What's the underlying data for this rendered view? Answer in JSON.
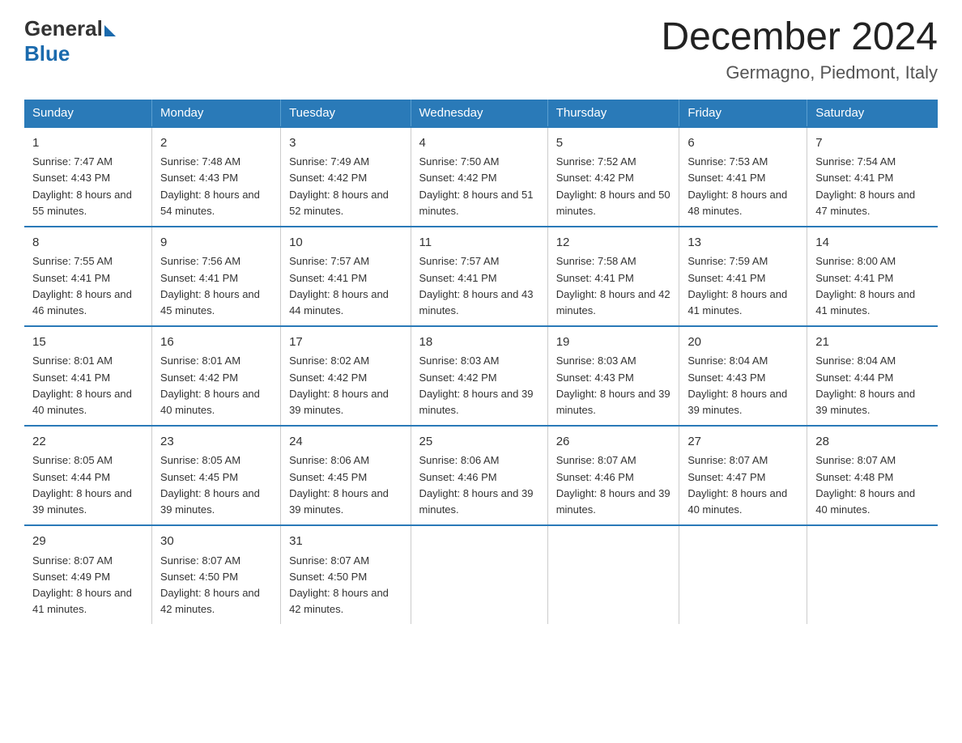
{
  "logo": {
    "general": "General",
    "blue": "Blue"
  },
  "title": "December 2024",
  "subtitle": "Germagno, Piedmont, Italy",
  "days_header": [
    "Sunday",
    "Monday",
    "Tuesday",
    "Wednesday",
    "Thursday",
    "Friday",
    "Saturday"
  ],
  "weeks": [
    [
      {
        "day": "1",
        "sunrise": "7:47 AM",
        "sunset": "4:43 PM",
        "daylight": "8 hours and 55 minutes."
      },
      {
        "day": "2",
        "sunrise": "7:48 AM",
        "sunset": "4:43 PM",
        "daylight": "8 hours and 54 minutes."
      },
      {
        "day": "3",
        "sunrise": "7:49 AM",
        "sunset": "4:42 PM",
        "daylight": "8 hours and 52 minutes."
      },
      {
        "day": "4",
        "sunrise": "7:50 AM",
        "sunset": "4:42 PM",
        "daylight": "8 hours and 51 minutes."
      },
      {
        "day": "5",
        "sunrise": "7:52 AM",
        "sunset": "4:42 PM",
        "daylight": "8 hours and 50 minutes."
      },
      {
        "day": "6",
        "sunrise": "7:53 AM",
        "sunset": "4:41 PM",
        "daylight": "8 hours and 48 minutes."
      },
      {
        "day": "7",
        "sunrise": "7:54 AM",
        "sunset": "4:41 PM",
        "daylight": "8 hours and 47 minutes."
      }
    ],
    [
      {
        "day": "8",
        "sunrise": "7:55 AM",
        "sunset": "4:41 PM",
        "daylight": "8 hours and 46 minutes."
      },
      {
        "day": "9",
        "sunrise": "7:56 AM",
        "sunset": "4:41 PM",
        "daylight": "8 hours and 45 minutes."
      },
      {
        "day": "10",
        "sunrise": "7:57 AM",
        "sunset": "4:41 PM",
        "daylight": "8 hours and 44 minutes."
      },
      {
        "day": "11",
        "sunrise": "7:57 AM",
        "sunset": "4:41 PM",
        "daylight": "8 hours and 43 minutes."
      },
      {
        "day": "12",
        "sunrise": "7:58 AM",
        "sunset": "4:41 PM",
        "daylight": "8 hours and 42 minutes."
      },
      {
        "day": "13",
        "sunrise": "7:59 AM",
        "sunset": "4:41 PM",
        "daylight": "8 hours and 41 minutes."
      },
      {
        "day": "14",
        "sunrise": "8:00 AM",
        "sunset": "4:41 PM",
        "daylight": "8 hours and 41 minutes."
      }
    ],
    [
      {
        "day": "15",
        "sunrise": "8:01 AM",
        "sunset": "4:41 PM",
        "daylight": "8 hours and 40 minutes."
      },
      {
        "day": "16",
        "sunrise": "8:01 AM",
        "sunset": "4:42 PM",
        "daylight": "8 hours and 40 minutes."
      },
      {
        "day": "17",
        "sunrise": "8:02 AM",
        "sunset": "4:42 PM",
        "daylight": "8 hours and 39 minutes."
      },
      {
        "day": "18",
        "sunrise": "8:03 AM",
        "sunset": "4:42 PM",
        "daylight": "8 hours and 39 minutes."
      },
      {
        "day": "19",
        "sunrise": "8:03 AM",
        "sunset": "4:43 PM",
        "daylight": "8 hours and 39 minutes."
      },
      {
        "day": "20",
        "sunrise": "8:04 AM",
        "sunset": "4:43 PM",
        "daylight": "8 hours and 39 minutes."
      },
      {
        "day": "21",
        "sunrise": "8:04 AM",
        "sunset": "4:44 PM",
        "daylight": "8 hours and 39 minutes."
      }
    ],
    [
      {
        "day": "22",
        "sunrise": "8:05 AM",
        "sunset": "4:44 PM",
        "daylight": "8 hours and 39 minutes."
      },
      {
        "day": "23",
        "sunrise": "8:05 AM",
        "sunset": "4:45 PM",
        "daylight": "8 hours and 39 minutes."
      },
      {
        "day": "24",
        "sunrise": "8:06 AM",
        "sunset": "4:45 PM",
        "daylight": "8 hours and 39 minutes."
      },
      {
        "day": "25",
        "sunrise": "8:06 AM",
        "sunset": "4:46 PM",
        "daylight": "8 hours and 39 minutes."
      },
      {
        "day": "26",
        "sunrise": "8:07 AM",
        "sunset": "4:46 PM",
        "daylight": "8 hours and 39 minutes."
      },
      {
        "day": "27",
        "sunrise": "8:07 AM",
        "sunset": "4:47 PM",
        "daylight": "8 hours and 40 minutes."
      },
      {
        "day": "28",
        "sunrise": "8:07 AM",
        "sunset": "4:48 PM",
        "daylight": "8 hours and 40 minutes."
      }
    ],
    [
      {
        "day": "29",
        "sunrise": "8:07 AM",
        "sunset": "4:49 PM",
        "daylight": "8 hours and 41 minutes."
      },
      {
        "day": "30",
        "sunrise": "8:07 AM",
        "sunset": "4:50 PM",
        "daylight": "8 hours and 42 minutes."
      },
      {
        "day": "31",
        "sunrise": "8:07 AM",
        "sunset": "4:50 PM",
        "daylight": "8 hours and 42 minutes."
      },
      null,
      null,
      null,
      null
    ]
  ]
}
